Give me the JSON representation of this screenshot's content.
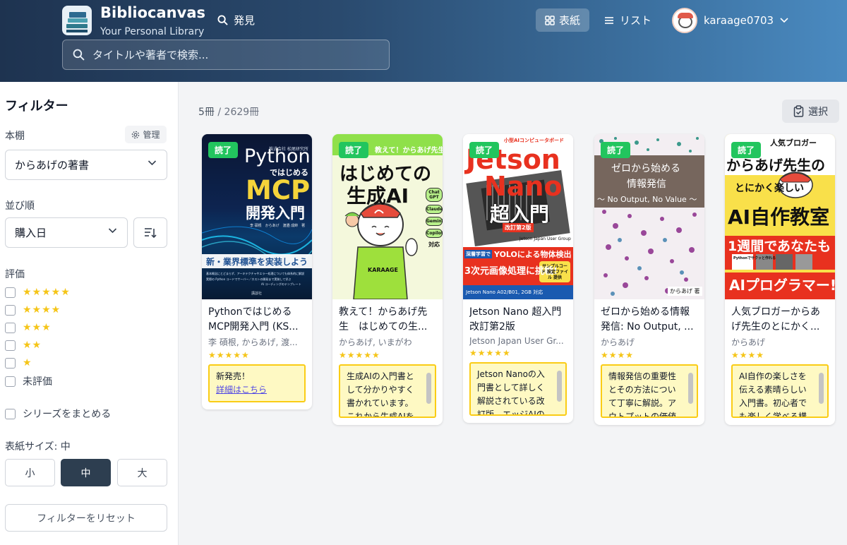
{
  "header": {
    "brand": "Bibliocanvas",
    "tagline": "Your Personal Library",
    "discover": "発見",
    "view_cover": "表紙",
    "view_list": "リスト",
    "username": "karaage0703",
    "search_placeholder": "タイトルや著者で検索..."
  },
  "sidebar": {
    "title": "フィルター",
    "shelf_label": "本棚",
    "manage_label": "管理",
    "shelf_value": "からあげの著書",
    "sort_label": "並び順",
    "sort_value": "購入日",
    "rating_label": "評価",
    "ratings": [
      {
        "stars": "★★★★★"
      },
      {
        "stars": "★★★★"
      },
      {
        "stars": "★★★"
      },
      {
        "stars": "★★"
      },
      {
        "stars": "★"
      },
      {
        "text": "未評価"
      }
    ],
    "series_label": "シリーズをまとめる",
    "cover_size_label": "表紙サイズ: 中",
    "sizes": [
      "小",
      "中",
      "大"
    ],
    "reset_label": "フィルターをリセット"
  },
  "main": {
    "count_current": "5冊",
    "count_total": " / 2629冊",
    "select_label": "選択",
    "books": [
      {
        "badge": "読了",
        "title": "PythonではじめるMCP開発入門 (KS...",
        "author": "李 碩根, からあげ, 渡...",
        "stars": "★★★★★",
        "note": "新発売！",
        "note_link": "詳細はこちら",
        "cover": {
          "publisher": "株式会社 松尾研究所",
          "line1": "Python",
          "line2": "ではじめる",
          "line3": "MCP",
          "line4": "開発入門",
          "authors": "李 碩根　からあげ　渡邉 成帥　著",
          "band": "新・業界標準を実装しよう",
          "small": "基本概念にとどまらず、アーキテクチャやエラー処理についても体系的に解説",
          "small2": "実際の Python コードでサーバー／ホストの開発まで実装して学ぶ",
          "small3": "AI コーディングのテンプレート",
          "footer": "講談社"
        }
      },
      {
        "badge": "読了",
        "title": "教えて！からあげ先生　はじめての生...",
        "author": "からあげ, いまがわ",
        "stars": "★★★★★",
        "note": "生成AIの入門書として分かりやすく書かれています。これから生成AIを",
        "cover": {
          "top": "教えて！からあげ先生",
          "line1": "はじめての",
          "line2": "生成AI",
          "tags": [
            "Chat GPT",
            "Claude",
            "Gemini",
            "Copilot"
          ],
          "tag_suffix": "対応",
          "shirt": "KARAAGE"
        }
      },
      {
        "badge": "読了",
        "title": "Jetson Nano 超入門 改訂第2版",
        "author": "Jetson Japan User Gr...",
        "stars": "★★★★★",
        "note": "Jetson Nanoの入門書として詳しく解説されている改訂版。エッジAIの",
        "cover": {
          "top": "小型AIコンピュータボード",
          "line1": "Jetson",
          "line2": "Nano",
          "line3": "超入門",
          "edition": "改訂第2版",
          "group": "Jetson Japan User Group",
          "red1": "深層学習で",
          "red1b": "YOLOによる物体検出",
          "red2": "3次元画像処理に挑戦!",
          "models": "Jetson Nano A02/B01, 2GB 対応",
          "sample": "サンプルコード 設定ファイル 提供"
        }
      },
      {
        "badge": "読了",
        "title": "ゼロから始める情報発信: No Output, ...",
        "author": "からあげ",
        "stars": "★★★★",
        "note": "情報発信の重要性とその方法について丁寧に解説。アウトプットの価値",
        "cover": {
          "line1": "ゼロから始める",
          "line2": "情報発信",
          "line3": "〜 No Output, No Value 〜",
          "author": "からあげ 著"
        }
      },
      {
        "badge": "読了",
        "title": "人気ブロガーからあげ先生のとにかく...",
        "author": "からあげ",
        "stars": "★★★★",
        "note": "AI自作の楽しさを伝える素晴らしい入門書。初心者でも楽しく学べる構",
        "cover": {
          "top": "人気ブロガー",
          "line1": "からあげ先生の",
          "line2": "とにかく楽しい",
          "line3": "AI自作教室",
          "line4": "1週間であなたも",
          "bottom": "AIプログラマー!",
          "sub": "Pythonでサクッと作れる"
        }
      }
    ]
  },
  "colors": {
    "badge_green": "#22c55e",
    "star_yellow": "#f5c518",
    "note_border": "#facc15",
    "active_size": "#2d3e50"
  }
}
